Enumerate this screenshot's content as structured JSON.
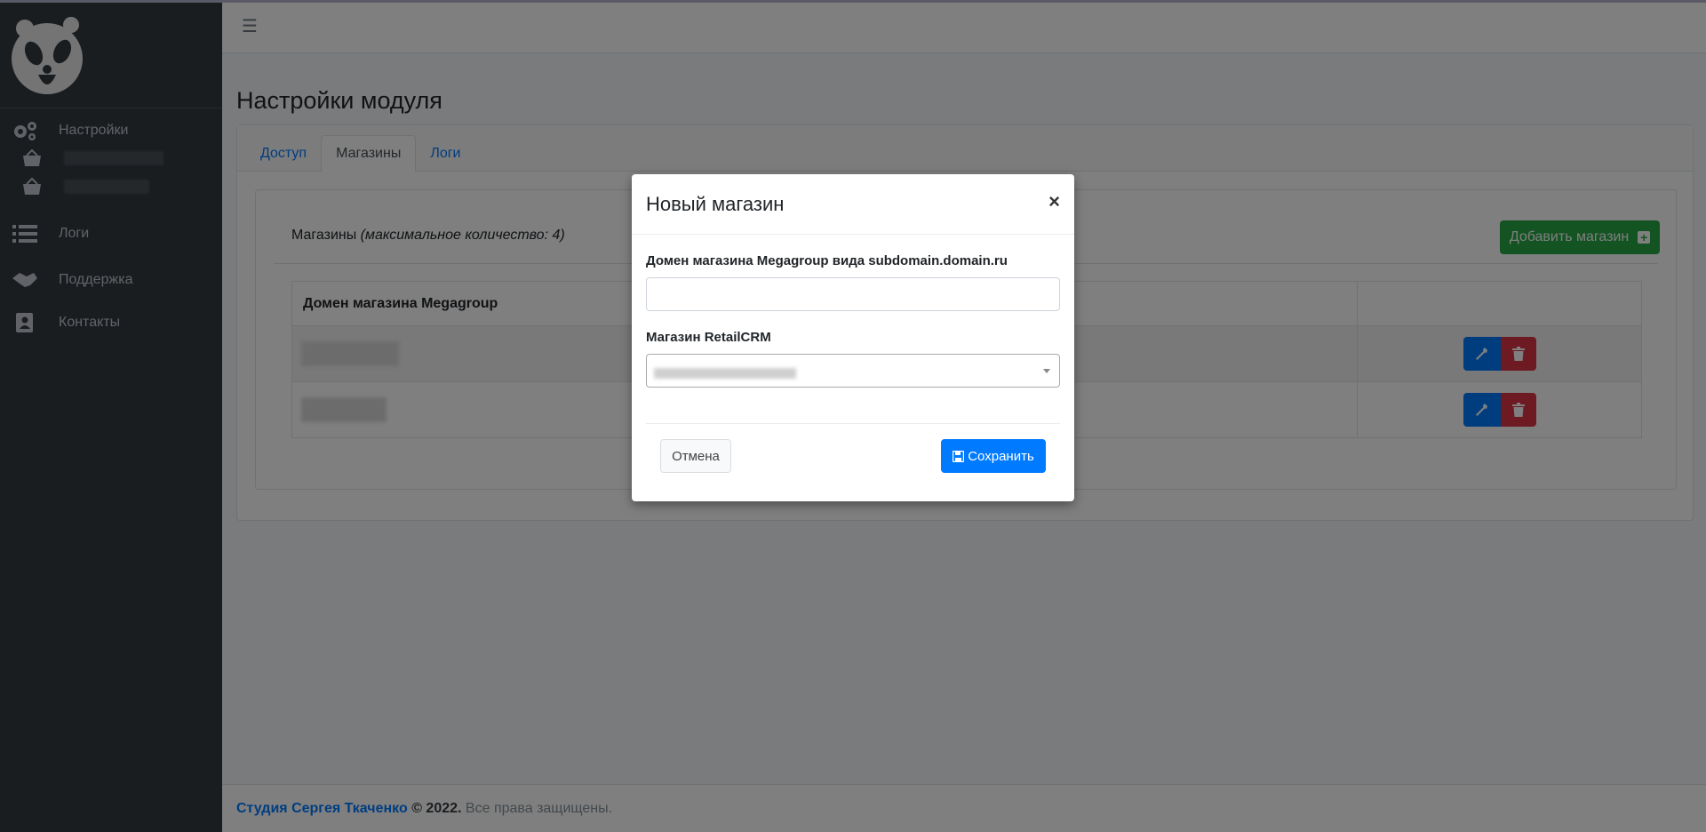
{
  "sidebar": {
    "items": [
      {
        "label": "Настройки",
        "icon": "gears-icon"
      },
      {
        "label": "Логи",
        "icon": "list-icon"
      },
      {
        "label": "Поддержка",
        "icon": "handshake-icon"
      },
      {
        "label": "Контакты",
        "icon": "address-book-icon"
      }
    ],
    "sub_items_icon": "basket-icon"
  },
  "header": {
    "menu_icon": "☰",
    "page_title": "Настройки модуля"
  },
  "tabs": [
    "Доступ",
    "Магазины",
    "Логи"
  ],
  "stores": {
    "title": "Магазины",
    "subtitle": "(максимальное количество: 4)",
    "add_button": "Добавить магазин",
    "column_domain": "Домен магазина Megagroup"
  },
  "footer": {
    "link": "Студия Сергея Ткаченко",
    "copyright": "© 2022.",
    "rights": "Все права защищены."
  },
  "modal": {
    "title": "Новый магазин",
    "close": "×",
    "domain_label": "Домен магазина Megagroup вида subdomain.domain.ru",
    "domain_value": "",
    "retail_label": "Магазин RetailCRM",
    "cancel": "Отмена",
    "save": "Сохранить"
  },
  "colors": {
    "sidebar_bg": "#343a40",
    "primary": "#007bff",
    "success": "#28a745",
    "danger": "#dc3545"
  }
}
